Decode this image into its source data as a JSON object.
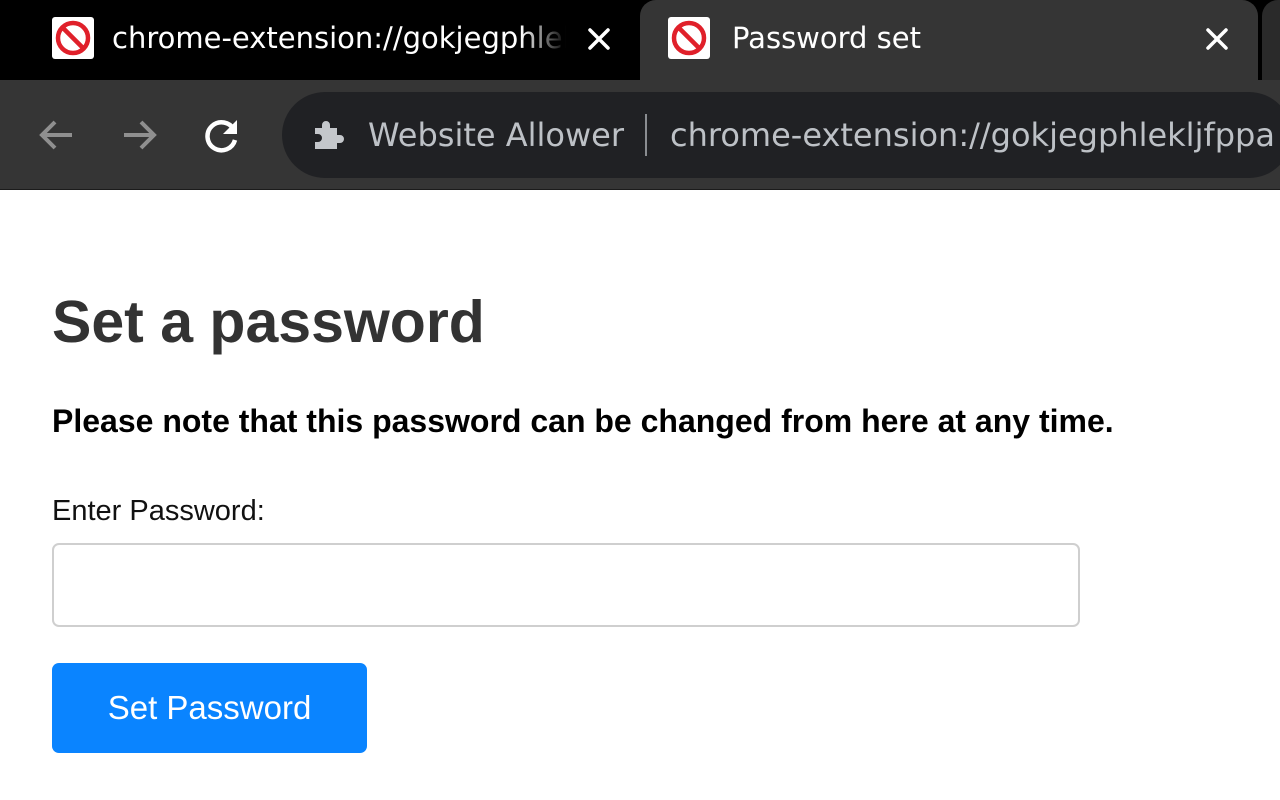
{
  "browser": {
    "tabs": [
      {
        "title": "chrome-extension://gokjegphleklj",
        "active": false,
        "favicon": "no-entry-icon"
      },
      {
        "title": "Password set",
        "active": true,
        "favicon": "no-entry-icon"
      }
    ],
    "address_bar": {
      "site_name": "Website Allower",
      "url": "chrome-extension://gokjegphlekljfppa",
      "icon": "puzzle-extension-icon"
    },
    "nav_icons": [
      "back-arrow-icon",
      "forward-arrow-icon",
      "reload-icon"
    ]
  },
  "page": {
    "title": "Set a password",
    "note": "Please note that this password can be changed from here at any time.",
    "password_label": "Enter Password:",
    "password_value": "",
    "button_label": "Set Password"
  },
  "colors": {
    "accent": "#0a84ff",
    "tabstrip_bg": "#000000",
    "toolbar_bg": "#353535",
    "omnibox_bg": "#202124",
    "favicon_red": "#e0202a"
  }
}
